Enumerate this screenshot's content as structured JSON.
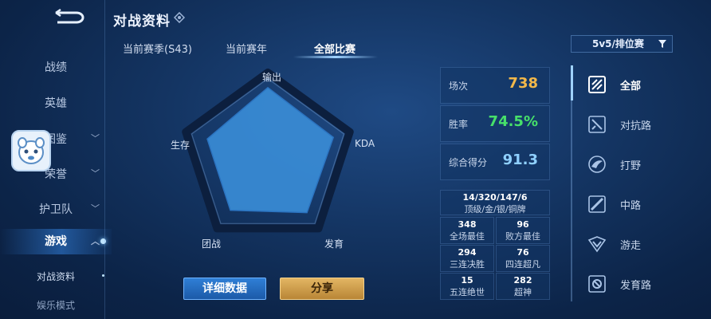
{
  "header": {
    "title": "对战资料"
  },
  "sidebar": {
    "items": [
      {
        "label": "战绩",
        "chevron": false
      },
      {
        "label": "英雄",
        "chevron": false
      },
      {
        "label": "图鉴",
        "chevron": true
      },
      {
        "label": "荣誉",
        "chevron": true
      },
      {
        "label": "护卫队",
        "chevron": true
      },
      {
        "label": "游戏",
        "chevron": true,
        "active": true
      }
    ],
    "subitems": [
      "对战资料",
      "娱乐模式"
    ]
  },
  "tabs": [
    {
      "label": "当前赛季(S43)"
    },
    {
      "label": "当前赛年"
    },
    {
      "label": "全部比赛",
      "active": true
    }
  ],
  "radar": {
    "axes": [
      "输出",
      "KDA",
      "发育",
      "团战",
      "生存"
    ],
    "levels": [
      0.96,
      0.93,
      0.9,
      0.86,
      0.86
    ]
  },
  "buttons": {
    "detail": "详细数据",
    "share": "分享"
  },
  "stats": [
    {
      "label": "场次",
      "value": "738",
      "color": "#f2b84a"
    },
    {
      "label": "胜率",
      "value": "74.5%",
      "color": "#47e06a"
    },
    {
      "label": "综合得分",
      "value": "91.3",
      "color": "#8fd0ff"
    }
  ],
  "medals": {
    "counts": "14/320/147/6",
    "label": "顶级/金/银/铜牌"
  },
  "records": [
    {
      "value": "348",
      "label": "全场最佳"
    },
    {
      "value": "96",
      "label": "败方最佳"
    },
    {
      "value": "294",
      "label": "三连决胜"
    },
    {
      "value": "76",
      "label": "四连超凡"
    },
    {
      "value": "15",
      "label": "五连绝世"
    },
    {
      "value": "282",
      "label": "超神"
    }
  ],
  "mode_filter": {
    "label": "5v5/排位赛"
  },
  "lanes": [
    {
      "label": "全部",
      "icon": "all-lanes-icon",
      "active": true
    },
    {
      "label": "对抗路",
      "icon": "clash-lane-icon"
    },
    {
      "label": "打野",
      "icon": "jungle-icon"
    },
    {
      "label": "中路",
      "icon": "mid-lane-icon"
    },
    {
      "label": "游走",
      "icon": "roam-icon"
    },
    {
      "label": "发育路",
      "icon": "farm-lane-icon"
    }
  ]
}
